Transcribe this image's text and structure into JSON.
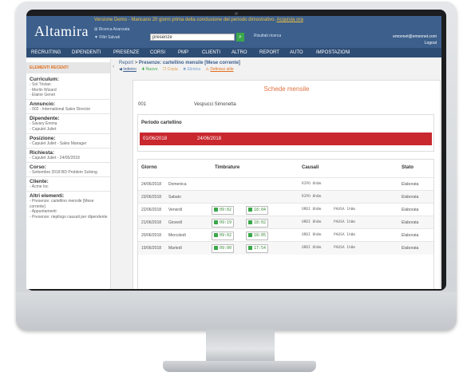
{
  "app": {
    "logo": "Altamira",
    "notice": "Versione Demo - Mancano 20 giorni prima della conclusione del periodo dimostrativo.",
    "notice_link": "Acquista ora",
    "advanced_search": "Ricerca Avanzata",
    "filter_saved": "Filtri Salvati",
    "search_value": "presenze",
    "search_results": "Risultati ricerca",
    "user_email": "emonnet@emonnet.com",
    "logout": "Logout"
  },
  "nav": [
    "RECRUITING",
    "DIPENDENTI",
    "PRESENZE",
    "CORSI",
    "PMP",
    "CLIENTI",
    "ALTRO",
    "REPORT",
    "AUTO",
    "IMPOSTAZIONI"
  ],
  "sidebar": {
    "header": "ELEMENTI RECENTI",
    "sections": [
      {
        "title": "Curriculum:",
        "items": [
          "- Sol Tristan",
          "- Merlin Wizard",
          "- Elaine Genet"
        ]
      },
      {
        "title": "Annuncio:",
        "items": [
          "- 002 - International Sales Director"
        ]
      },
      {
        "title": "Dipendente:",
        "items": [
          "- Savary Emma",
          "- Capulet Juliet"
        ]
      },
      {
        "title": "Posizione:",
        "items": [
          "- Capulet Juliet - Sales Manager"
        ]
      },
      {
        "title": "Richiesta:",
        "items": [
          "- Capulet Juliet - 24/05/2018"
        ]
      },
      {
        "title": "Corso:",
        "items": [
          "- Settembre 2018 BD Problem Solving"
        ]
      },
      {
        "title": "Cliente:",
        "items": [
          "- Acme Inc"
        ]
      },
      {
        "title": "Altri elementi:",
        "items": [
          "- Presenze: cartellino mensile [Mese corrente]",
          "- Appuntamenti",
          "- Presenze: riepilogo causali per dipendente"
        ]
      }
    ]
  },
  "main": {
    "breadcrumb_root": "Report",
    "breadcrumb_sep": ">",
    "breadcrumb_title": "Presenze: cartellino mensile [Mese corrente]",
    "actions": [
      "Indietro",
      "Nuovo",
      "Copia",
      "Elimina",
      "Definisci stile"
    ],
    "card_title": "Schede mensile",
    "employee_id": "001",
    "employee_name": "Vespucci Simonetta",
    "period_label": "Periodo cartellino",
    "period_from": "01/06/2018",
    "period_to": "24/06/2018",
    "table_headers": [
      "Giorno",
      "Timbrature",
      "Causali",
      "Stato"
    ],
    "rows": [
      {
        "date": "24/06/2018",
        "day": "Domenica",
        "in": "",
        "out": "",
        "causal": "RIPO  8h0m",
        "causal2": "",
        "state": "Elaborata"
      },
      {
        "date": "23/06/2018",
        "day": "Sabato",
        "in": "",
        "out": "",
        "causal": "RIPO  8h0m",
        "causal2": "",
        "state": "Elaborata"
      },
      {
        "date": "22/06/2018",
        "day": "Venerdì",
        "in": "09:02",
        "out": "18:04",
        "causal": "ORDI  8h0m",
        "causal2": "PAUSA  1h0m",
        "state": "Elaborata"
      },
      {
        "date": "21/06/2018",
        "day": "Giovedì",
        "in": "09:19",
        "out": "18:02",
        "causal": "ORDI  8h0m",
        "causal2": "PAUSA  1h0m",
        "state": "Elaborata"
      },
      {
        "date": "20/06/2018",
        "day": "Mercoledì",
        "in": "09:02",
        "out": "18:05",
        "causal": "ORDI  8h0m",
        "causal2": "PAUSA  1h0m",
        "state": "Elaborata"
      },
      {
        "date": "19/06/2018",
        "day": "Martedì",
        "in": "09:00",
        "out": "17:54",
        "causal": "ORDI  8h0m",
        "causal2": "PAUSA  1h0m",
        "state": "Elaborata"
      }
    ]
  }
}
